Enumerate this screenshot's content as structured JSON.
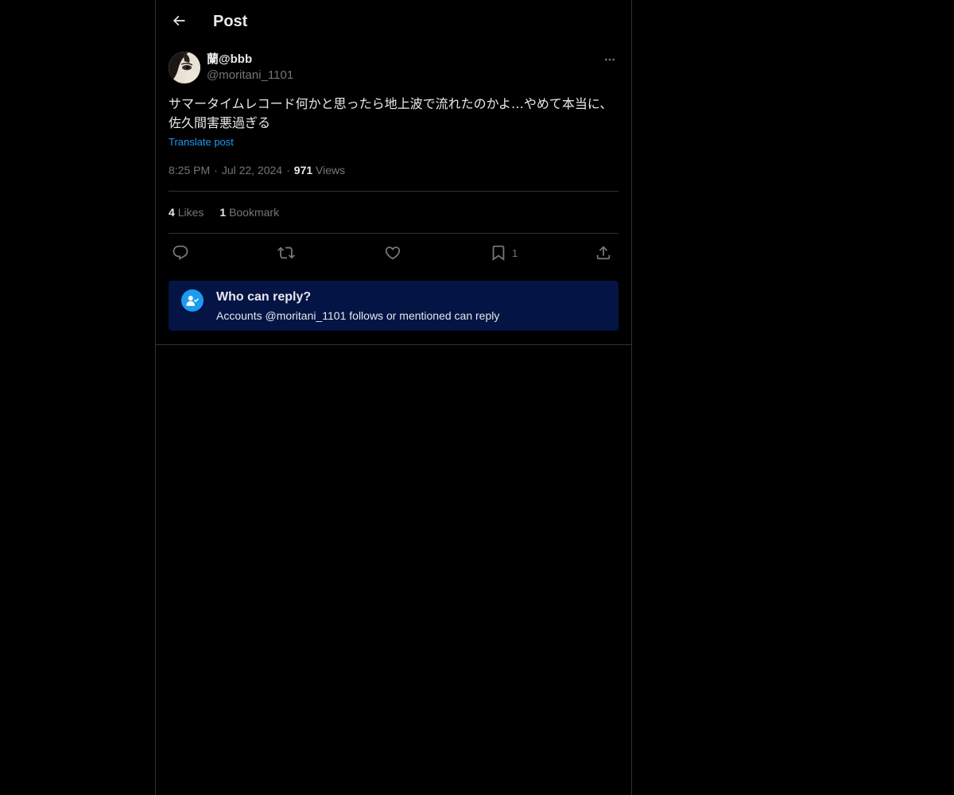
{
  "header": {
    "back_icon": "arrow-left-icon",
    "title": "Post"
  },
  "author": {
    "display_name": "蘭@bbb",
    "handle": "@moritani_1101",
    "avatar_icon": "avatar-photo",
    "more_icon": "more-horizontal-icon"
  },
  "post": {
    "text": "サマータイムレコード何かと思ったら地上波で流れたのかよ…やめて本当に、佐久間害悪過ぎる",
    "translate_label": "Translate post"
  },
  "meta": {
    "time": "8:25 PM",
    "date": "Jul 22, 2024",
    "views_count": "971",
    "views_label": "Views",
    "separator": "·"
  },
  "stats": {
    "likes_count": "4",
    "likes_label": "Likes",
    "bookmarks_count": "1",
    "bookmarks_label": "Bookmark"
  },
  "actions": {
    "reply_icon": "reply-icon",
    "repost_icon": "repost-icon",
    "like_icon": "heart-icon",
    "bookmark_icon": "bookmark-icon",
    "bookmark_count": "1",
    "share_icon": "share-icon"
  },
  "reply_restriction": {
    "icon": "person-check-icon",
    "title": "Who can reply?",
    "description": "Accounts @moritani_1101 follows or mentioned can reply"
  },
  "colors": {
    "background": "#000000",
    "text_primary": "#e7e9ea",
    "text_secondary": "#71767b",
    "accent": "#1d9bf0",
    "border": "#2f3336",
    "reply_box_bg": "#031445"
  }
}
